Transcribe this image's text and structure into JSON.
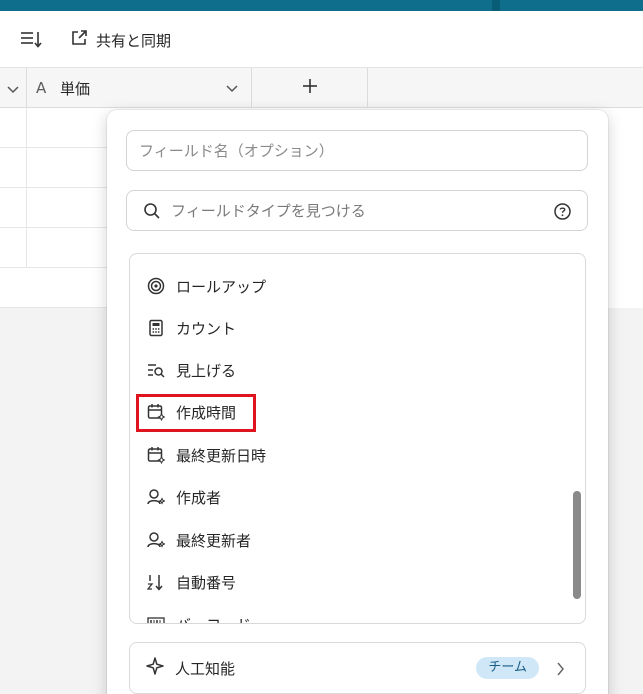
{
  "toolbar": {
    "sort_icon": "sort-lines-icon",
    "share_icon": "external-link-icon",
    "share_label": "共有と同期"
  },
  "grid": {
    "column_type_glyph": "A",
    "column_label": "単価",
    "add_column_icon": "plus-icon"
  },
  "panel": {
    "field_name_placeholder": "フィールド名（オプション）",
    "search_placeholder": "フィールドタイプを見つける",
    "field_types": [
      {
        "label": "ロールアップ",
        "icon": "rollup-icon"
      },
      {
        "label": "カウント",
        "icon": "calculator-icon"
      },
      {
        "label": "見上げる",
        "icon": "lookup-icon"
      },
      {
        "label": "作成時間",
        "icon": "calendar-created-icon"
      },
      {
        "label": "最終更新日時",
        "icon": "calendar-modified-icon"
      },
      {
        "label": "作成者",
        "icon": "user-created-icon"
      },
      {
        "label": "最終更新者",
        "icon": "user-modified-icon"
      },
      {
        "label": "自動番号",
        "icon": "autonumber-icon"
      },
      {
        "label": "バーコード",
        "icon": "barcode-icon"
      }
    ],
    "ai": {
      "label": "人工知能",
      "badge": "チーム",
      "icon": "sparkle-icon"
    }
  },
  "colors": {
    "topbar": "#0f6e8c",
    "highlight": "#e0141e",
    "badge_bg": "#cfe7f7",
    "badge_text": "#1a5d86"
  }
}
